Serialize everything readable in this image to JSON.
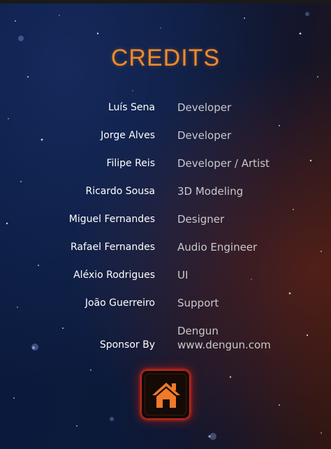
{
  "title": "CREDITS",
  "credits": [
    {
      "name": "Luís Sena",
      "role": "Developer"
    },
    {
      "name": "Jorge Alves",
      "role": "Developer"
    },
    {
      "name": "Filipe Reis",
      "role": "Developer / Artist"
    },
    {
      "name": "Ricardo Sousa",
      "role": "3D Modeling"
    },
    {
      "name": "Miguel Fernandes",
      "role": "Designer"
    },
    {
      "name": "Rafael Fernandes",
      "role": "Audio Engineer"
    },
    {
      "name": "Aléxio Rodrigues",
      "role": "UI"
    },
    {
      "name": "João Guerreiro",
      "role": "Support"
    }
  ],
  "sponsor": {
    "label": "Sponsor By",
    "line1": "Dengun",
    "line2": "www.dengun.com"
  },
  "home_button": {
    "icon": "home-icon"
  },
  "colors": {
    "title": "#f08a2a",
    "name": "#ffffff",
    "role": "#c9c9c9",
    "home_icon": "#f07a2a",
    "home_glow": "#ff3214"
  }
}
